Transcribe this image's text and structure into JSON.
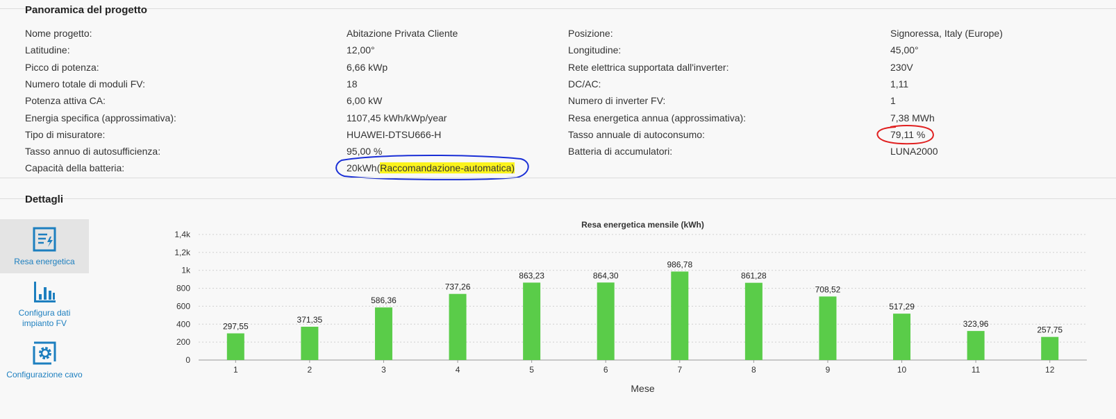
{
  "overview": {
    "title": "Panoramica del progetto",
    "left": [
      {
        "label": "Nome progetto:",
        "value": "Abitazione Privata Cliente"
      },
      {
        "label": "Latitudine:",
        "value": "12,00°"
      },
      {
        "label": "Picco di potenza:",
        "value": "6,66 kWp"
      },
      {
        "label": "Numero totale di moduli FV:",
        "value": "18"
      },
      {
        "label": "Potenza attiva CA:",
        "value": "6,00 kW"
      },
      {
        "label": "Energia specifica (approssimativa):",
        "value": "1107,45 kWh/kWp/year"
      },
      {
        "label": "Tipo di misuratore:",
        "value": "HUAWEI-DTSU666-H"
      },
      {
        "label": "Tasso annuo di autosufficienza:",
        "value": "95,00 %"
      },
      {
        "label": "Capacità della batteria:",
        "value": "20kWh",
        "value_paren_open": "(",
        "value_highlight": "Raccomandazione-automatica)"
      }
    ],
    "right": [
      {
        "label": "Posizione:",
        "value": "Signoressa, Italy (Europe)"
      },
      {
        "label": "Longitudine:",
        "value": "45,00°"
      },
      {
        "label": "Rete elettrica supportata dall'inverter:",
        "value": "230V"
      },
      {
        "label": "DC/AC:",
        "value": "1,11"
      },
      {
        "label": "Numero di inverter FV:",
        "value": "1"
      },
      {
        "label": "Resa energetica annua (approssimativa):",
        "value": "7,38 MWh"
      },
      {
        "label": "Tasso annuale di autoconsumo:",
        "value": "79,11 %"
      },
      {
        "label": "Batteria di accumulatori:",
        "value": "LUNA2000"
      }
    ]
  },
  "details": {
    "title": "Dettagli"
  },
  "sidebar": {
    "items": [
      {
        "label": "Resa energetica",
        "icon": "energy-yield-icon",
        "active": true
      },
      {
        "label": "Configura dati impianto FV",
        "icon": "bar-chart-icon",
        "active": false
      },
      {
        "label": "Configurazione cavo",
        "icon": "gear-icon",
        "active": false
      }
    ]
  },
  "colors": {
    "bar": "#5acc49",
    "accent": "#1d7fbf",
    "annotation_blue": "#1a2fd6",
    "annotation_red": "#e02020",
    "highlight": "#fbf31d"
  },
  "chart_data": {
    "type": "bar",
    "title": "Resa energetica mensile (kWh)",
    "xlabel": "Mese",
    "ylabel": "",
    "categories": [
      "1",
      "2",
      "3",
      "4",
      "5",
      "6",
      "7",
      "8",
      "9",
      "10",
      "11",
      "12"
    ],
    "values": [
      297.55,
      371.35,
      586.36,
      737.26,
      863.23,
      864.3,
      986.78,
      861.28,
      708.52,
      517.29,
      323.96,
      257.75
    ],
    "value_labels": [
      "297,55",
      "371,35",
      "586,36",
      "737,26",
      "863,23",
      "864,30",
      "986,78",
      "861,28",
      "708,52",
      "517,29",
      "323,96",
      "257,75"
    ],
    "ylim": [
      0,
      1400
    ],
    "yticks": [
      0,
      200,
      400,
      600,
      800,
      1000,
      1200,
      1400
    ],
    "ytick_labels": [
      "0",
      "200",
      "400",
      "600",
      "800",
      "1k",
      "1,2k",
      "1,4k"
    ],
    "grid": true
  }
}
